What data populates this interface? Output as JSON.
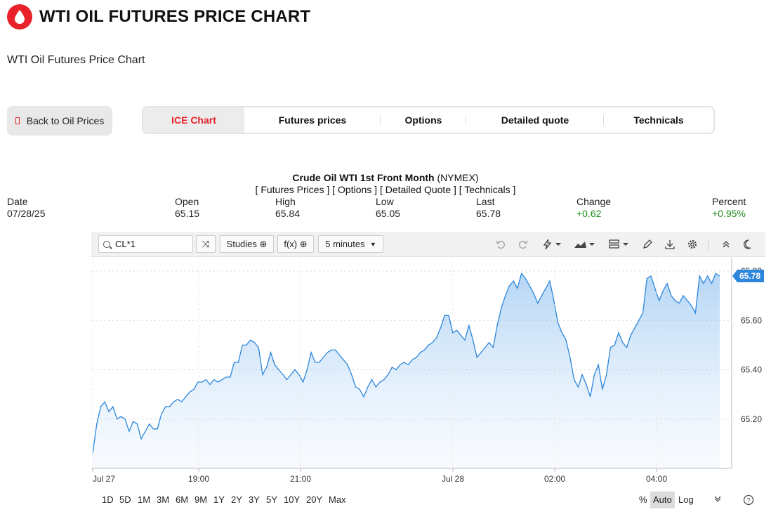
{
  "header": {
    "title": "WTI OIL FUTURES PRICE CHART",
    "subtitle": "WTI Oil Futures Price Chart",
    "brand_color": "#e8212a"
  },
  "nav": {
    "back_label": "Back to Oil Prices",
    "tabs": [
      {
        "label": "ICE Chart",
        "active": true
      },
      {
        "label": "Futures prices",
        "active": false
      },
      {
        "label": "Options",
        "active": false
      },
      {
        "label": "Detailed quote",
        "active": false
      },
      {
        "label": "Technicals",
        "active": false
      }
    ]
  },
  "quote": {
    "name": "Crude Oil WTI 1st Front Month",
    "exchange": "(NYMEX)",
    "links": "[ Futures Prices ] [ Options ] [ Detailed Quote ] [ Technicals ]",
    "labels": {
      "date": "Date",
      "open": "Open",
      "high": "High",
      "low": "Low",
      "last": "Last",
      "change": "Change",
      "percent": "Percent"
    },
    "values": {
      "date": "07/28/25",
      "open": "65.15",
      "high": "65.84",
      "low": "65.05",
      "last": "65.78",
      "change": "+0.62",
      "percent": "+0.95%"
    }
  },
  "toolbar": {
    "symbol": "CL*1",
    "studies_label": "Studies",
    "fx_label": "f(x)",
    "interval_label": "5 minutes"
  },
  "chart_data": {
    "type": "area",
    "x_ticks": [
      "Jul 27",
      "19:00",
      "21:00",
      "Jul 28",
      "02:00",
      "04:00"
    ],
    "y_ticks": [
      "65.20",
      "65.40",
      "65.60",
      "65.80"
    ],
    "ylim": [
      65.0,
      65.82
    ],
    "last_label": "65.78",
    "values": [
      65.06,
      65.18,
      65.25,
      65.27,
      65.23,
      65.25,
      65.2,
      65.21,
      65.2,
      65.15,
      65.19,
      65.18,
      65.12,
      65.15,
      65.18,
      65.16,
      65.16,
      65.22,
      65.25,
      65.25,
      65.27,
      65.28,
      65.27,
      65.29,
      65.31,
      65.32,
      65.35,
      65.35,
      65.36,
      65.34,
      65.36,
      65.35,
      65.36,
      65.37,
      65.37,
      65.43,
      65.43,
      65.5,
      65.5,
      65.52,
      65.51,
      65.49,
      65.38,
      65.41,
      65.47,
      65.42,
      65.4,
      65.38,
      65.36,
      65.38,
      65.4,
      65.38,
      65.35,
      65.4,
      65.47,
      65.43,
      65.43,
      65.45,
      65.47,
      65.48,
      65.48,
      65.46,
      65.44,
      65.42,
      65.38,
      65.33,
      65.32,
      65.29,
      65.33,
      65.36,
      65.33,
      65.35,
      65.36,
      65.38,
      65.41,
      65.4,
      65.42,
      65.43,
      65.42,
      65.44,
      65.45,
      65.47,
      65.48,
      65.5,
      65.51,
      65.53,
      65.57,
      65.62,
      65.62,
      65.55,
      65.56,
      65.54,
      65.52,
      65.58,
      65.52,
      65.45,
      65.47,
      65.49,
      65.51,
      65.49,
      65.58,
      65.65,
      65.7,
      65.74,
      65.76,
      65.73,
      65.79,
      65.77,
      65.74,
      65.71,
      65.67,
      65.7,
      65.73,
      65.76,
      65.68,
      65.59,
      65.55,
      65.52,
      65.45,
      65.36,
      65.33,
      65.38,
      65.34,
      65.29,
      65.38,
      65.42,
      65.32,
      65.38,
      65.49,
      65.5,
      65.55,
      65.51,
      65.49,
      65.54,
      65.57,
      65.6,
      65.63,
      65.77,
      65.78,
      65.73,
      65.68,
      65.72,
      65.75,
      65.7,
      65.68,
      65.67,
      65.7,
      65.68,
      65.66,
      65.63,
      65.78,
      65.75,
      65.78,
      65.75,
      65.79,
      65.78
    ]
  },
  "range": {
    "items": [
      "1D",
      "5D",
      "1M",
      "3M",
      "6M",
      "9M",
      "1Y",
      "2Y",
      "3Y",
      "5Y",
      "10Y",
      "20Y",
      "Max"
    ],
    "percent": "%",
    "auto": "Auto",
    "log": "Log"
  }
}
